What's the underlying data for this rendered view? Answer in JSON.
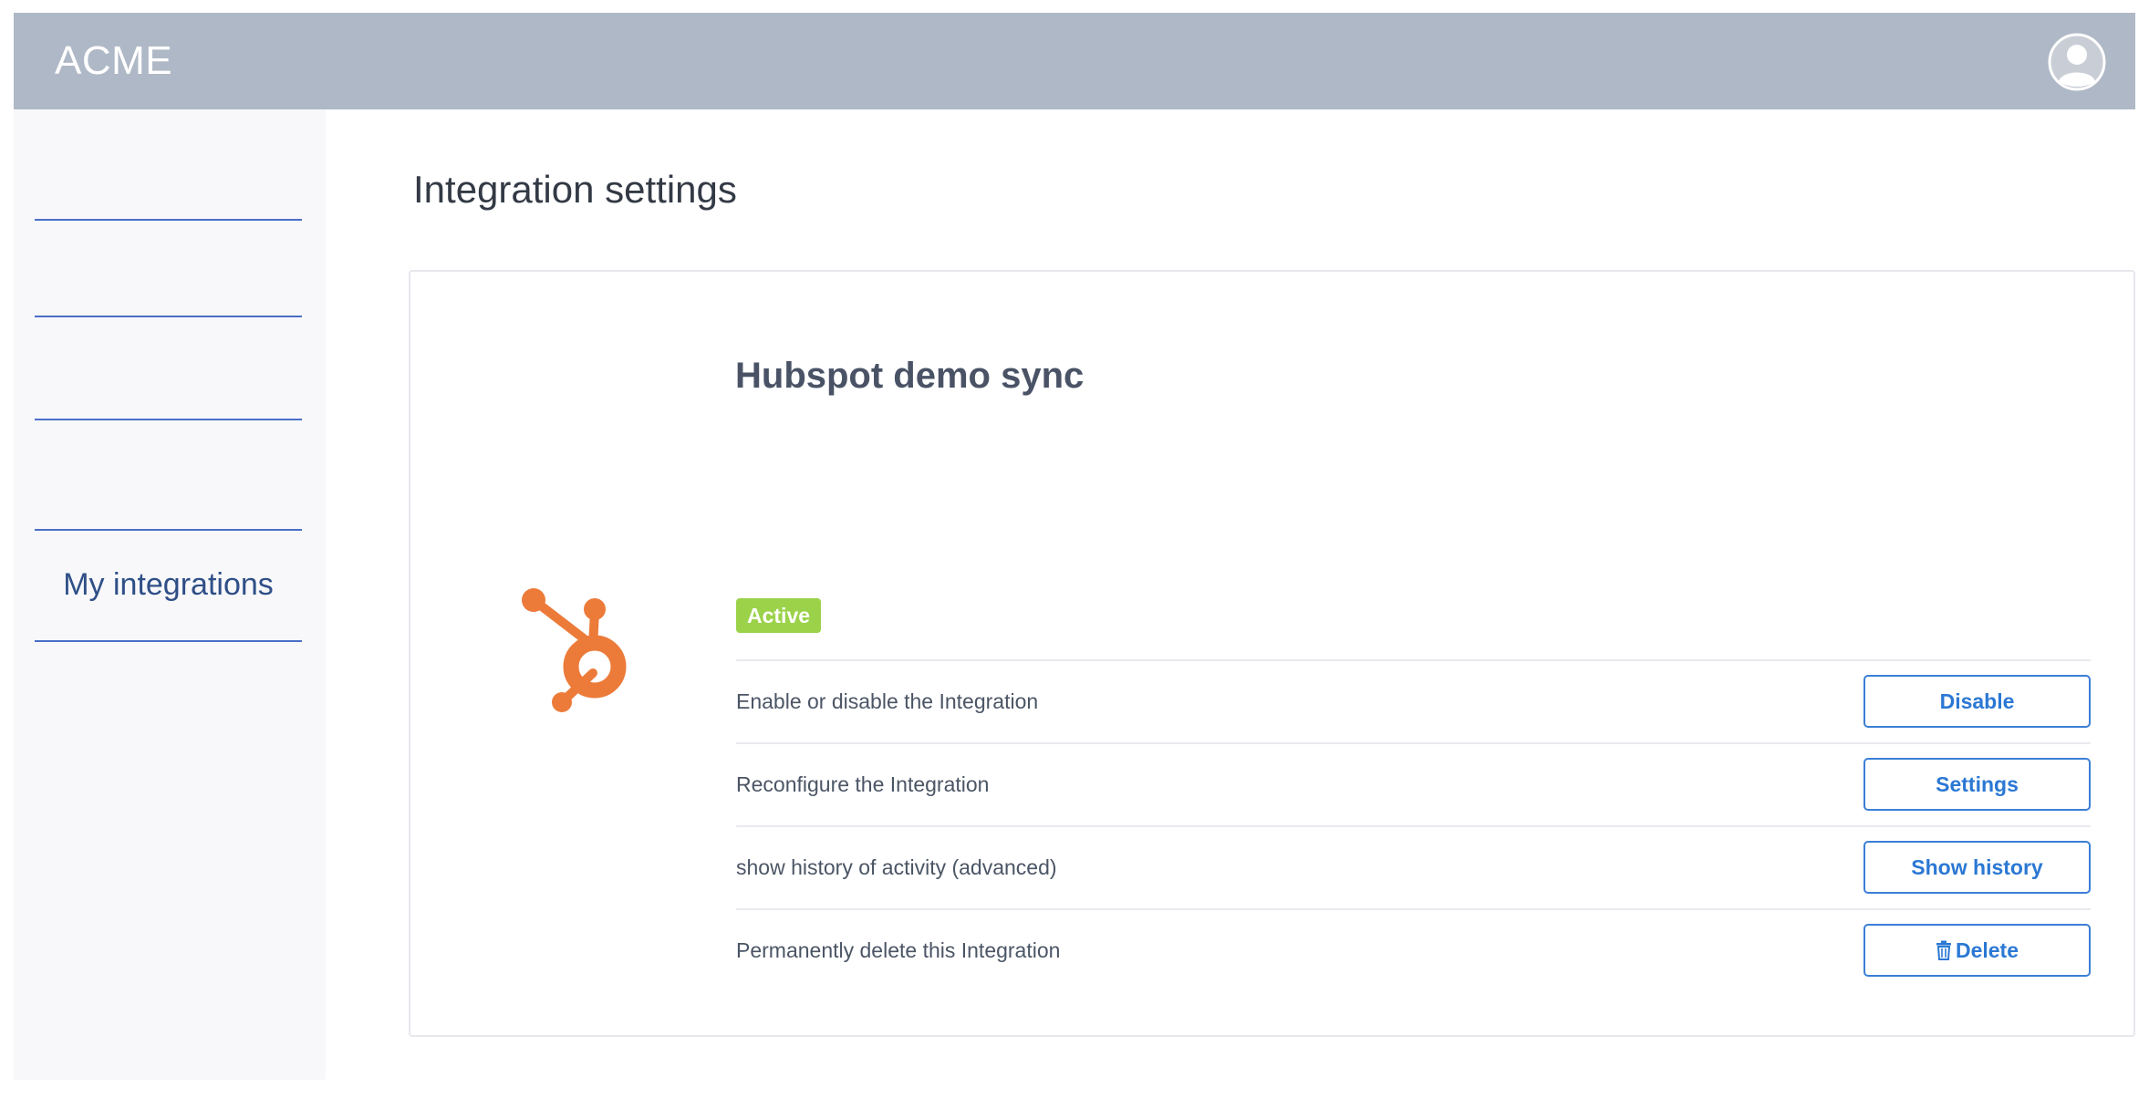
{
  "app": {
    "brand": "ACME"
  },
  "sidebar": {
    "items": [
      {
        "label": ""
      },
      {
        "label": ""
      },
      {
        "label": ""
      },
      {
        "label": "My integrations"
      }
    ]
  },
  "main": {
    "title": "Integration settings"
  },
  "integration": {
    "name": "Hubspot demo sync",
    "status": "Active",
    "logo_icon": "hubspot-logo-icon",
    "rows": [
      {
        "label": "Enable or disable the Integration",
        "button": "Disable"
      },
      {
        "label": "Reconfigure the Integration",
        "button": "Settings"
      },
      {
        "label": "show history of activity (advanced)",
        "button": "Show history"
      },
      {
        "label": "Permanently delete this Integration",
        "button": "Delete",
        "icon": "trash-icon"
      }
    ]
  },
  "colors": {
    "topbar": "#afb8c6",
    "accent": "#2b78d4",
    "status_active": "#9bd24a",
    "hubspot_orange": "#ec7b3a",
    "nav_line": "#4a6fc6"
  }
}
